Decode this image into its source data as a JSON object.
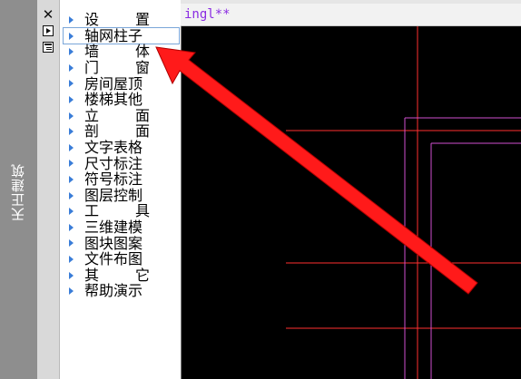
{
  "window": {
    "vertical_title": "天正建筑"
  },
  "tools": {
    "close_glyph": "✕"
  },
  "menu": {
    "items": [
      {
        "label": "设　置",
        "spread": true
      },
      {
        "label": "轴网柱子",
        "spread": false,
        "selected": true
      },
      {
        "label": "墙　体",
        "spread": true
      },
      {
        "label": "门　窗",
        "spread": true
      },
      {
        "label": "房间屋顶",
        "spread": false
      },
      {
        "label": "楼梯其他",
        "spread": false
      },
      {
        "label": "立　面",
        "spread": true
      },
      {
        "label": "剖　面",
        "spread": true
      },
      {
        "label": "文字表格",
        "spread": false
      },
      {
        "label": "尺寸标注",
        "spread": false
      },
      {
        "label": "符号标注",
        "spread": false
      },
      {
        "label": "图层控制",
        "spread": false
      },
      {
        "label": "工　具",
        "spread": true
      },
      {
        "label": "三维建模",
        "spread": false
      },
      {
        "label": "图块图案",
        "spread": false
      },
      {
        "label": "文件布图",
        "spread": false
      },
      {
        "label": "其　它",
        "spread": true
      },
      {
        "label": "帮助演示",
        "spread": false
      }
    ]
  },
  "drawing": {
    "tab_label": "ingl**",
    "colors": {
      "background": "#000000",
      "red_lines": "#ff3030",
      "magenta_lines": "#d050d0",
      "arrow": "#ff1a1a"
    }
  }
}
